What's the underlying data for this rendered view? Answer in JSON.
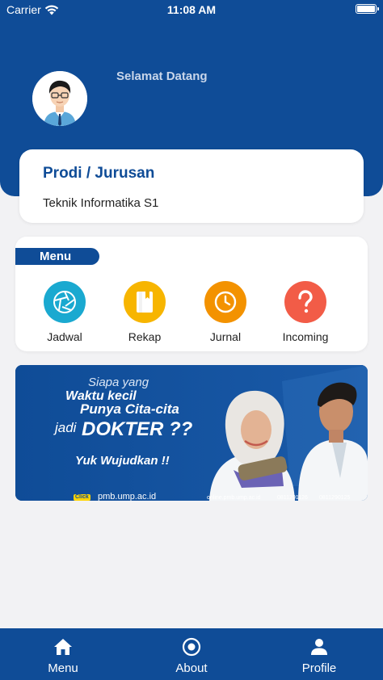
{
  "status_bar": {
    "carrier": "Carrier",
    "time": "11:08 AM"
  },
  "header": {
    "greeting": "Selamat Datang"
  },
  "prodi": {
    "title": "Prodi / Jurusan",
    "value": "Teknik Informatika S1"
  },
  "menu": {
    "title": "Menu",
    "items": [
      {
        "label": "Jadwal",
        "icon": "aperture-icon",
        "color": "#1aa9d0"
      },
      {
        "label": "Rekap",
        "icon": "book-icon",
        "color": "#f7b500"
      },
      {
        "label": "Jurnal",
        "icon": "clock-icon",
        "color": "#f39200"
      },
      {
        "label": "Incoming",
        "icon": "question-icon",
        "color": "#f25c47"
      }
    ]
  },
  "banner": {
    "line1": "Siapa yang",
    "line2": "Waktu kecil",
    "line3": "Punya Cita-cita",
    "line4": "jadi",
    "line5": "DOKTER ??",
    "line6": "Yuk Wujudkan !!",
    "click": "Click",
    "website": "pmb.ump.ac.id",
    "online": "online.pmb.ump.ac.id",
    "whatsapp": "0811291126",
    "call": "0811290125"
  },
  "tab_bar": {
    "items": [
      {
        "label": "Menu",
        "icon": "home-icon"
      },
      {
        "label": "About",
        "icon": "target-icon"
      },
      {
        "label": "Profile",
        "icon": "person-icon"
      }
    ]
  },
  "colors": {
    "primary": "#0f4c97",
    "background": "#f2f2f4"
  }
}
